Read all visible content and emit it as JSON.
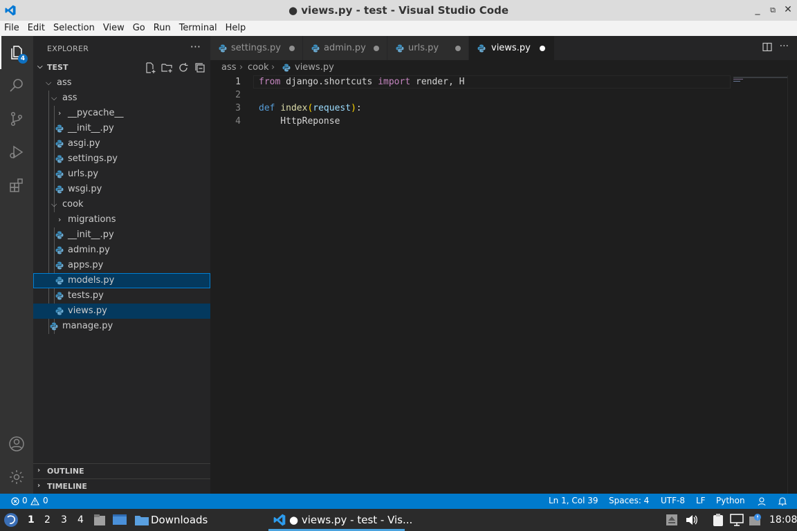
{
  "window": {
    "title": "● views.py - test - Visual Studio Code",
    "controls": [
      "_",
      "⧉",
      "✕"
    ]
  },
  "menu": [
    "File",
    "Edit",
    "Selection",
    "View",
    "Go",
    "Run",
    "Terminal",
    "Help"
  ],
  "activity": {
    "explorer_badge": "4"
  },
  "sidebar": {
    "title": "EXPLORER",
    "more": "···",
    "folder": "TEST",
    "tree": [
      {
        "label": "ass",
        "type": "folder-open"
      },
      {
        "label": "ass",
        "type": "folder-open"
      },
      {
        "label": "__pycache__",
        "type": "folder-closed"
      },
      {
        "label": "__init__.py",
        "type": "py"
      },
      {
        "label": "asgi.py",
        "type": "py"
      },
      {
        "label": "settings.py",
        "type": "py"
      },
      {
        "label": "urls.py",
        "type": "py"
      },
      {
        "label": "wsgi.py",
        "type": "py"
      },
      {
        "label": "cook",
        "type": "folder-open"
      },
      {
        "label": "migrations",
        "type": "folder-closed"
      },
      {
        "label": "__init__.py",
        "type": "py"
      },
      {
        "label": "admin.py",
        "type": "py"
      },
      {
        "label": "apps.py",
        "type": "py"
      },
      {
        "label": "models.py",
        "type": "py"
      },
      {
        "label": "tests.py",
        "type": "py"
      },
      {
        "label": "views.py",
        "type": "py"
      },
      {
        "label": "manage.py",
        "type": "py"
      }
    ],
    "outline": "OUTLINE",
    "timeline": "TIMELINE"
  },
  "tabs": [
    {
      "label": "settings.py",
      "active": false
    },
    {
      "label": "admin.py",
      "active": false
    },
    {
      "label": "urls.py",
      "active": false
    },
    {
      "label": "views.py",
      "active": true
    }
  ],
  "breadcrumb": [
    "ass",
    "cook",
    "views.py"
  ],
  "editor": {
    "line_numbers": [
      "1",
      "2",
      "3",
      "4"
    ],
    "line1": {
      "kw_from": "from",
      "module": " django.shortcuts ",
      "kw_import": "import",
      "names": " render, H"
    },
    "line3": {
      "kw_def": "def",
      "fn": "index",
      "open": "(",
      "param": "request",
      "close": ")",
      "colon": ":"
    },
    "line4": {
      "text": "    HttpReponse"
    }
  },
  "status": {
    "errors": "0",
    "warnings": "0",
    "position": "Ln 1, Col 39",
    "spaces": "Spaces: 4",
    "encoding": "UTF-8",
    "eol": "LF",
    "language": "Python"
  },
  "taskbar": {
    "workspaces": [
      "1",
      "2",
      "3",
      "4"
    ],
    "downloads": "Downloads",
    "vscode_window": "● views.py - test - Vis...",
    "clock": "18:08"
  },
  "colors": {
    "accent": "#007acc",
    "selection": "#04395e",
    "keyword": "#c586c0",
    "function": "#dcdcaa"
  }
}
